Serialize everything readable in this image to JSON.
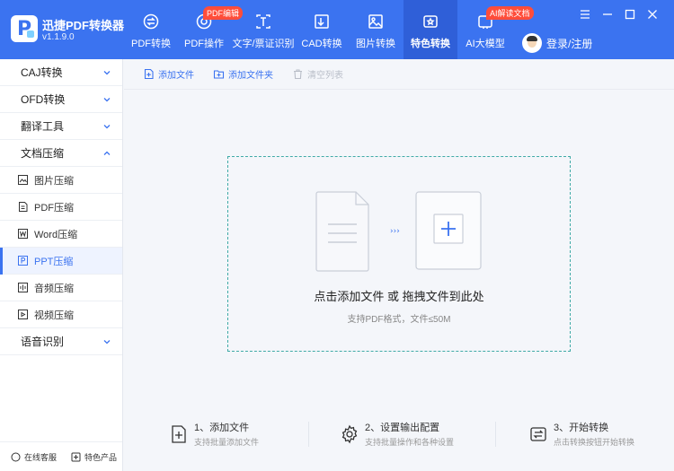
{
  "app": {
    "name": "迅捷PDF转换器",
    "version": "v1.1.9.0"
  },
  "nav": [
    {
      "label": "PDF转换",
      "icon": "pdf-convert-icon"
    },
    {
      "label": "PDF操作",
      "icon": "pdf-operate-icon",
      "badge": "PDF编辑"
    },
    {
      "label": "文字/票证识别",
      "icon": "text-recognition-icon"
    },
    {
      "label": "CAD转换",
      "icon": "cad-convert-icon"
    },
    {
      "label": "图片转换",
      "icon": "image-convert-icon"
    },
    {
      "label": "特色转换",
      "icon": "special-convert-icon",
      "active": true
    },
    {
      "label": "AI大模型",
      "icon": "ai-model-icon",
      "badge": "AI解读文档"
    }
  ],
  "user": {
    "login_label": "登录/注册"
  },
  "sidebar": {
    "groups": [
      {
        "label": "CAJ转换"
      },
      {
        "label": "OFD转换"
      },
      {
        "label": "翻译工具"
      },
      {
        "label": "文档压缩"
      },
      {
        "label": "语音识别"
      }
    ],
    "compress_items": [
      {
        "label": "图片压缩",
        "icon": "image-compress-icon"
      },
      {
        "label": "PDF压缩",
        "icon": "pdf-compress-icon"
      },
      {
        "label": "Word压缩",
        "icon": "word-compress-icon"
      },
      {
        "label": "PPT压缩",
        "icon": "ppt-compress-icon",
        "active": true
      },
      {
        "label": "音频压缩",
        "icon": "audio-compress-icon"
      },
      {
        "label": "视频压缩",
        "icon": "video-compress-icon"
      }
    ],
    "footer": {
      "service_label": "在线客服",
      "products_label": "特色产品"
    }
  },
  "toolbar": {
    "add_file": "添加文件",
    "add_folder": "添加文件夹",
    "clear_list": "清空列表"
  },
  "dropzone": {
    "title": "点击添加文件 或 拖拽文件到此处",
    "subtitle": "支持PDF格式，文件≤50M"
  },
  "steps": [
    {
      "title": "1、添加文件",
      "subtitle": "支持批量添加文件",
      "icon": "add-file-icon"
    },
    {
      "title": "2、设置输出配置",
      "subtitle": "支持批量操作和各种设置",
      "icon": "settings-gear-icon"
    },
    {
      "title": "3、开始转换",
      "subtitle": "点击转换按钮开始转换",
      "icon": "convert-icon"
    }
  ],
  "colors": {
    "primary": "#3b73f0",
    "header_active": "#2f5fd8",
    "badge": "#ff4d3a",
    "dropzone_border": "#3faaa6"
  }
}
